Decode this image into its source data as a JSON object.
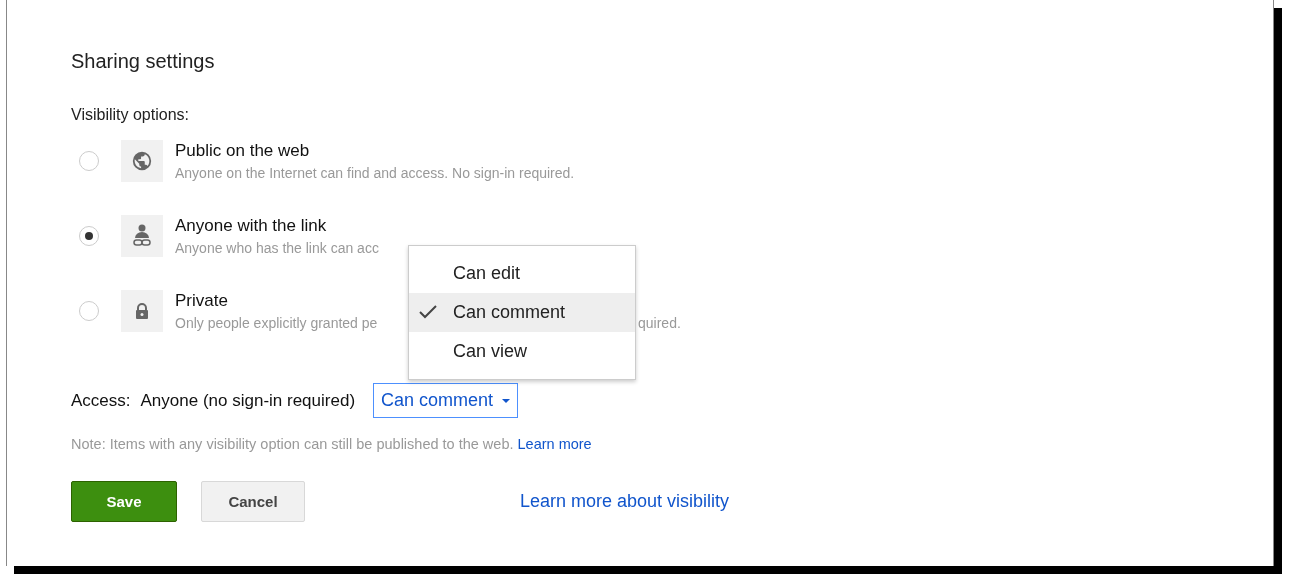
{
  "title": "Sharing settings",
  "visibility_label": "Visibility options:",
  "options": [
    {
      "kind": "globe",
      "title": "Public on the web",
      "description": "Anyone on the Internet can find and access. No sign-in required.",
      "selected": false
    },
    {
      "kind": "link",
      "title": "Anyone with the link",
      "description": "Anyone who has the link can acc",
      "selected": true
    },
    {
      "kind": "lock",
      "title": "Private",
      "description": "Only people explicitly granted pe",
      "description_tail": "quired.",
      "selected": false
    }
  ],
  "access": {
    "label": "Access:",
    "value": "Anyone (no sign-in required)",
    "dropdown": "Can comment"
  },
  "menu": [
    {
      "label": "Can edit",
      "selected": false
    },
    {
      "label": "Can comment",
      "selected": true
    },
    {
      "label": "Can view",
      "selected": false
    }
  ],
  "note": {
    "text": "Note: Items with any visibility option can still be published to the web.",
    "link": "Learn more"
  },
  "buttons": {
    "save": "Save",
    "cancel": "Cancel"
  },
  "visibility_link": "Learn more about visibility"
}
